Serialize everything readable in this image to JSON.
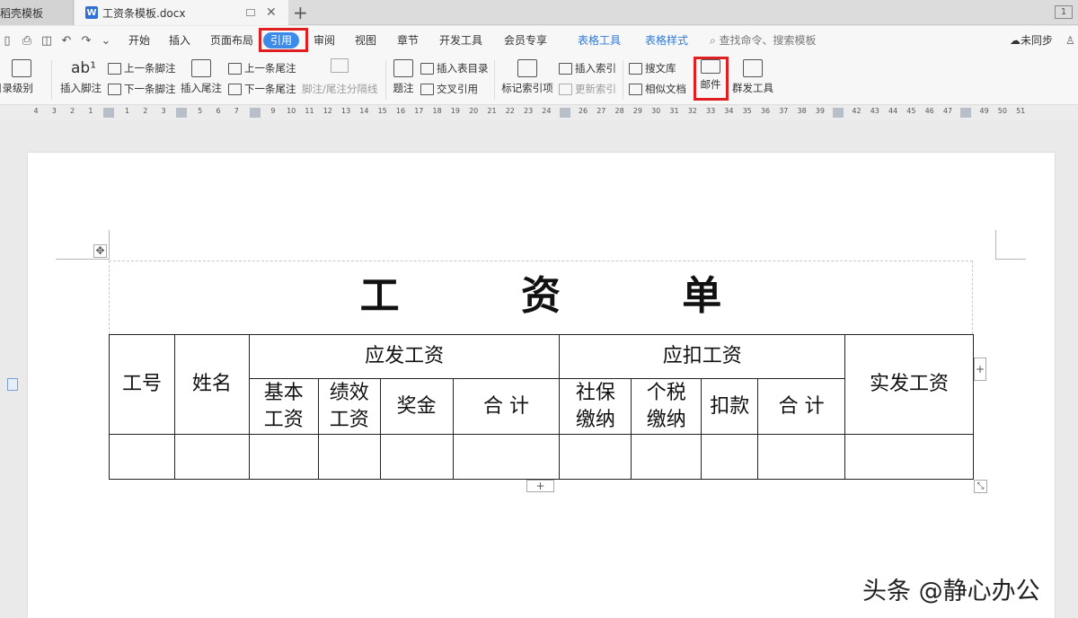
{
  "tabs": {
    "tab1_label": "找稻壳模板",
    "tab2_label": "工资条模板.docx",
    "tab2_icon": "W",
    "add": "+",
    "window_count": "1"
  },
  "menu": {
    "items": [
      "开始",
      "插入",
      "页面布局",
      "引用",
      "审阅",
      "视图",
      "章节",
      "开发工具",
      "会员专享",
      "表格工具",
      "表格样式"
    ],
    "active": "引用",
    "search": "查找命令、搜索模板",
    "sync": "未同步",
    "share": "心"
  },
  "ribbon": {
    "toc_level": "目录级别",
    "insert_footnote": "插入脚注",
    "prev_footnote": "上一条脚注",
    "next_footnote": "下一条脚注",
    "insert_endnote": "插入尾注",
    "prev_endnote": "上一条尾注",
    "next_endnote": "下一条尾注",
    "separator": "脚注/尾注分隔线",
    "caption": "题注",
    "insert_table_toc": "插入表目录",
    "cross_ref": "交叉引用",
    "mark_index": "标记索引项",
    "insert_index": "插入索引",
    "update_index": "更新索引",
    "search_lib": "搜文库",
    "similar_doc": "相似文档",
    "mail": "邮件",
    "mass_tool": "群发工具"
  },
  "ruler": [
    "4",
    "3",
    "2",
    "1",
    "",
    "1",
    "2",
    "3",
    "",
    "5",
    "6",
    "7",
    "",
    "9",
    "10",
    "11",
    "12",
    "13",
    "14",
    "15",
    "16",
    "17",
    "18",
    "19",
    "20",
    "21",
    "22",
    "23",
    "24",
    "",
    "26",
    "27",
    "28",
    "29",
    "30",
    "31",
    "32",
    "33",
    "34",
    "35",
    "36",
    "37",
    "38",
    "39",
    "",
    "42",
    "43",
    "44",
    "45",
    "46",
    "47",
    "",
    "49",
    "50",
    "51"
  ],
  "document": {
    "title": "工 资 单",
    "headers": {
      "id": "工号",
      "name": "姓名",
      "payable": "应发工资",
      "deductions": "应扣工资",
      "net": "实发工资",
      "base_line1": "基本",
      "base_line2": "工资",
      "perf_line1": "绩效",
      "perf_line2": "工资",
      "bonus": "奖金",
      "subtotal1": "合 计",
      "social_line1": "社保",
      "social_line2": "缴纳",
      "tax_line1": "个税",
      "tax_line2": "缴纳",
      "deduct": "扣款",
      "subtotal2": "合 计"
    }
  },
  "watermark": "头条 @静心办公"
}
